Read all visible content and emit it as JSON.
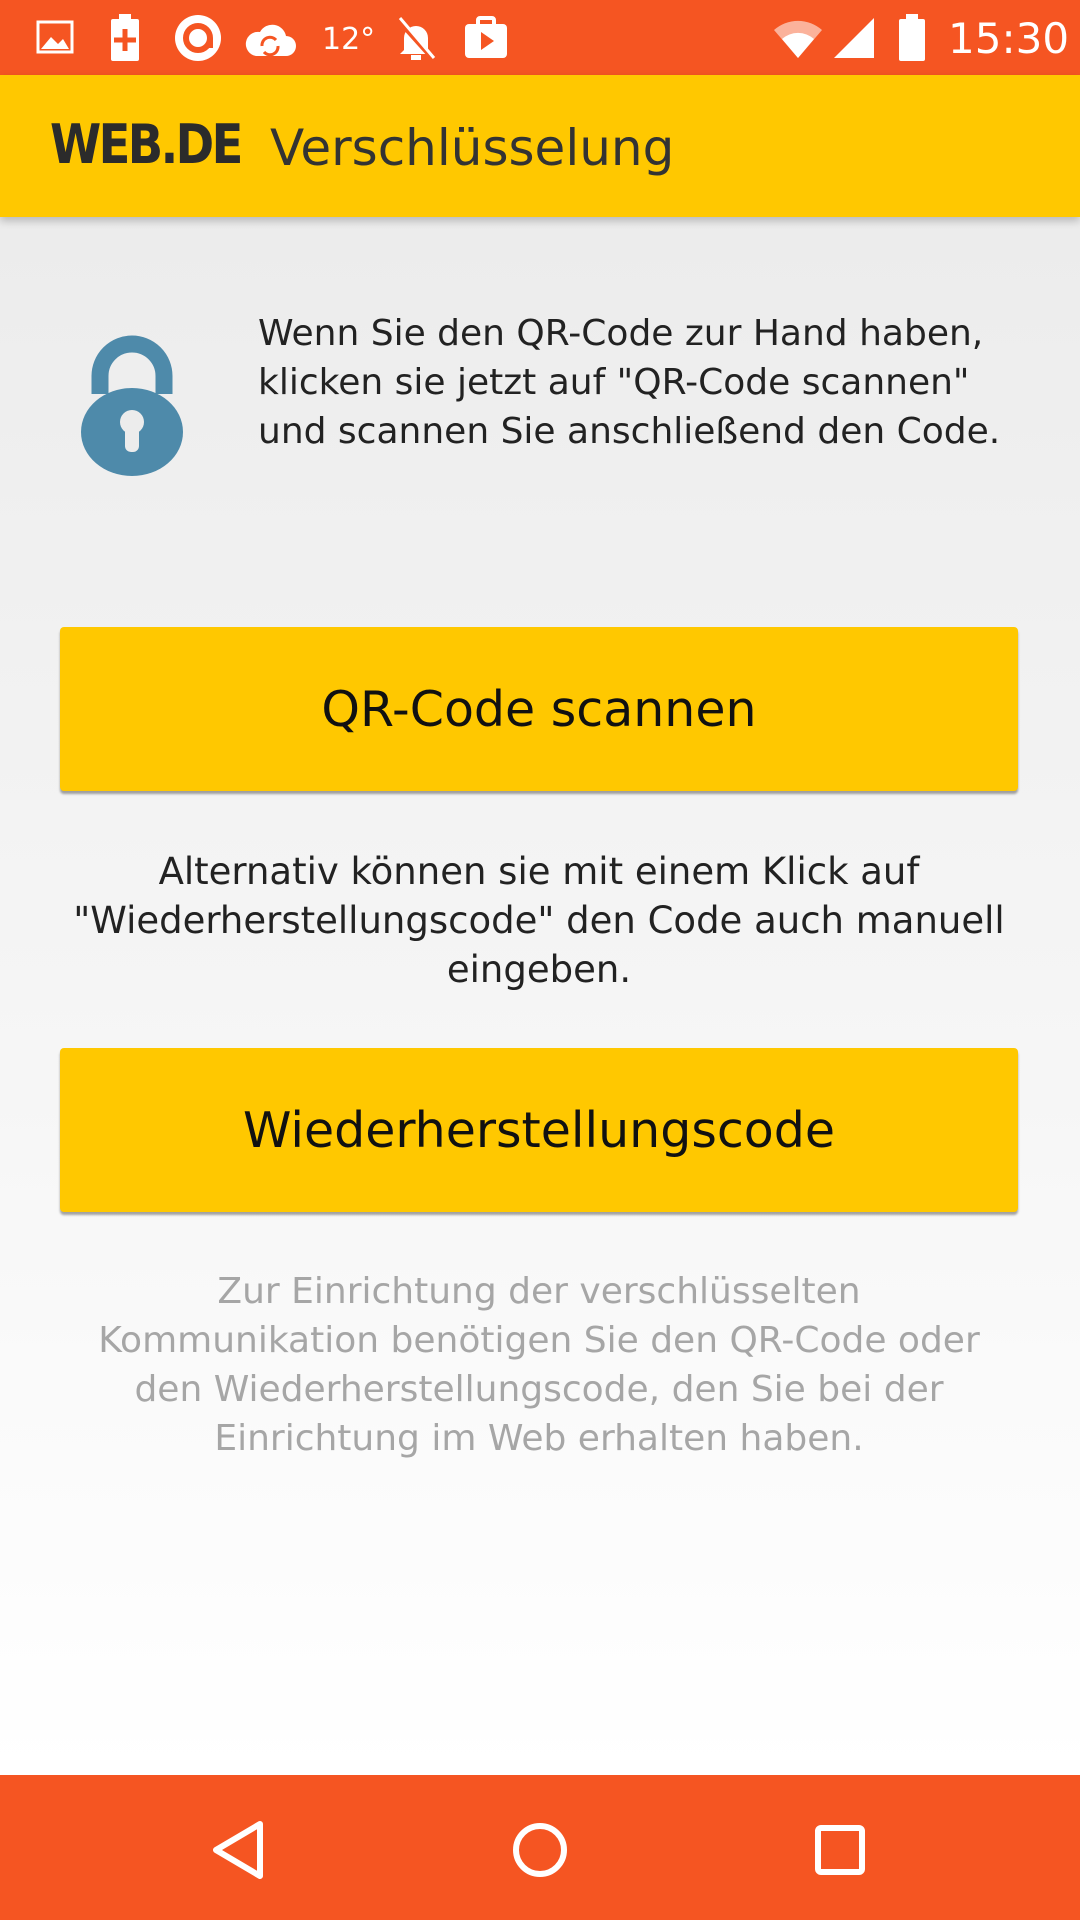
{
  "status_bar": {
    "temperature": "12°",
    "time": "15:30",
    "icons": [
      "image-icon",
      "battery-plus-icon",
      "app-at-icon",
      "cloud-sync-icon",
      "alarm-off-icon",
      "briefcase-play-icon",
      "wifi-icon",
      "cell-signal-icon",
      "battery-icon"
    ]
  },
  "app_bar": {
    "logo": "WEB.DE",
    "title": "Verschlüsselung"
  },
  "content": {
    "intro_text": "Wenn Sie den QR-Code zur Hand haben, klicken sie jetzt auf \"QR-Code scannen\" und scannen Sie anschließend den Code.",
    "qr_button_label": "QR-Code scannen",
    "alternative_text": "Alternativ können sie mit einem Klick auf \"Wiederherstellungscode\" den Code auch manuell eingeben.",
    "restore_button_label": "Wiederherstellungscode",
    "hint_text": "Zur Einrichtung der verschlüsselten Kommunikation benötigen Sie den QR-Code oder den Wiederherstellungscode, den Sie bei der Einrichtung im Web erhalten haben."
  },
  "colors": {
    "status_bar": "#f55522",
    "app_bar": "#ffc800",
    "button": "#ffc800",
    "lock_icon": "#4e8aaa",
    "hint_text": "#a6a6a6"
  },
  "nav_bar": {
    "icons": [
      "back-icon",
      "home-icon",
      "recents-icon"
    ]
  }
}
